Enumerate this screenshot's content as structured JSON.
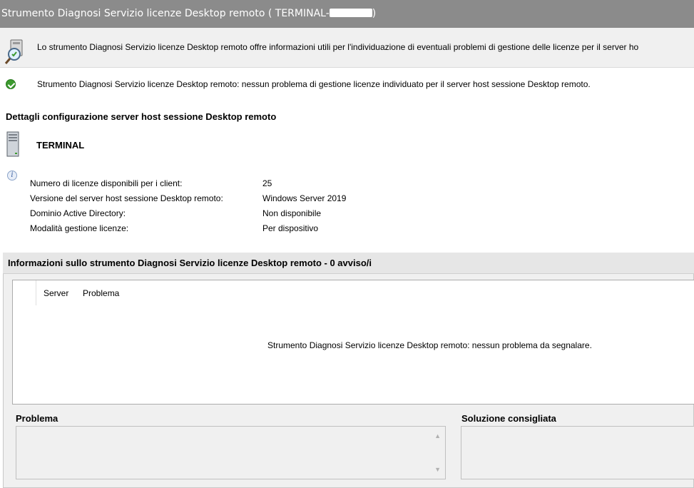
{
  "window": {
    "title": "Strumento Diagnosi Servizio licenze Desktop remoto ( TERMINAL-",
    "title_suffix": ")"
  },
  "infobar": {
    "icon": "diagnostic-tool-icon",
    "text": "Lo strumento Diagnosi Servizio licenze Desktop remoto offre informazioni utili per l'individuazione di eventuali problemi di gestione delle licenze per il server ho"
  },
  "status": {
    "icon": "check-success-icon",
    "text": "Strumento Diagnosi Servizio licenze Desktop remoto: nessun problema di gestione licenze individuato per il server host sessione Desktop remoto."
  },
  "config": {
    "title": "Dettagli configurazione server host sessione Desktop remoto",
    "server_name": "TERMINAL",
    "rows": [
      {
        "label": "Numero di licenze disponibili per i client:",
        "value": "25"
      },
      {
        "label": "Versione del server host sessione Desktop remoto:",
        "value": "Windows Server 2019"
      },
      {
        "label": "Dominio Active Directory:",
        "value": "Non disponibile"
      },
      {
        "label": "Modalità gestione licenze:",
        "value": "Per dispositivo"
      }
    ]
  },
  "panel": {
    "header": "Informazioni sullo strumento Diagnosi Servizio licenze Desktop remoto - 0 avviso/i",
    "columns": {
      "server": "Server",
      "problem": "Problema"
    },
    "empty_message": "Strumento Diagnosi Servizio licenze Desktop remoto: nessun problema da segnalare.",
    "problem_label": "Problema",
    "solution_label": "Soluzione consigliata"
  },
  "colors": {
    "titlebar": "#8b8b8b",
    "success": "#3b9a2e"
  }
}
